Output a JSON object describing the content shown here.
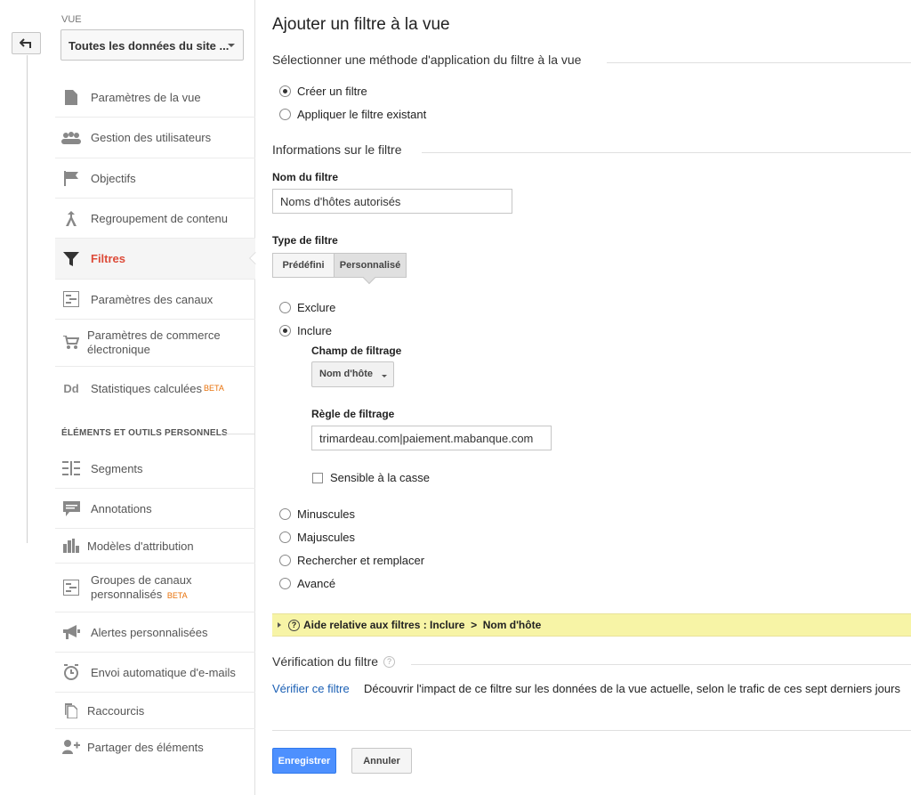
{
  "sidebar": {
    "view_label": "VUE",
    "view_select": "Toutes les données du site ...",
    "items": [
      {
        "label": "Paramètres de la vue",
        "icon": "document-icon"
      },
      {
        "label": "Gestion des utilisateurs",
        "icon": "users-icon"
      },
      {
        "label": "Objectifs",
        "icon": "flag-icon"
      },
      {
        "label": "Regroupement de contenu",
        "icon": "merge-icon"
      },
      {
        "label": "Filtres",
        "icon": "filter-icon"
      },
      {
        "label": "Paramètres des canaux",
        "icon": "channels-icon"
      },
      {
        "label": "Paramètres de commerce électronique",
        "icon": "cart-icon"
      },
      {
        "label": "Statistiques calculées",
        "icon": "dd-icon",
        "badge": "BETA"
      }
    ],
    "section_title": "ÉLÉMENTS ET OUTILS PERSONNELS",
    "personal_items": [
      {
        "label": "Segments",
        "icon": "segments-icon"
      },
      {
        "label": "Annotations",
        "icon": "comment-icon"
      },
      {
        "label": "Modèles d'attribution",
        "icon": "bar-chart-icon"
      },
      {
        "label": "Groupes de canaux personnalisés",
        "icon": "channels-icon",
        "badge": "BETA"
      },
      {
        "label": "Alertes personnalisées",
        "icon": "megaphone-icon"
      },
      {
        "label": "Envoi automatique d'e-mails",
        "icon": "clock-icon"
      },
      {
        "label": "Raccourcis",
        "icon": "copy-icon"
      },
      {
        "label": "Partager des éléments",
        "icon": "add-user-icon"
      }
    ]
  },
  "main": {
    "title": "Ajouter un filtre à la vue",
    "method_heading": "Sélectionner une méthode d'application du filtre à la vue",
    "method_options": [
      "Créer un filtre",
      "Appliquer le filtre existant"
    ],
    "info_heading": "Informations sur le filtre",
    "name_label": "Nom du filtre",
    "name_value": "Noms d'hôtes autorisés",
    "type_label": "Type de filtre",
    "type_tabs": [
      "Prédéfini",
      "Personnalisé"
    ],
    "custom_options": [
      "Exclure",
      "Inclure",
      "Minuscules",
      "Majuscules",
      "Rechercher et remplacer",
      "Avancé"
    ],
    "field_label": "Champ de filtrage",
    "field_value": "Nom d'hôte",
    "rule_label": "Règle de filtrage",
    "rule_value": "trimardeau.com|paiement.mabanque.com",
    "case_label": "Sensible à la casse",
    "help_text": "Aide relative aux filtres : Inclure  >  Nom d'hôte",
    "verify_heading": "Vérification du filtre",
    "verify_link": "Vérifier ce filtre",
    "verify_desc": "Découvrir l'impact de ce filtre sur les données de la vue actuelle, selon le trafic de ces sept derniers jours",
    "save_label": "Enregistrer",
    "cancel_label": "Annuler"
  },
  "colors": {
    "accent_active": "#dd4b39",
    "primary_button": "#4d90fe",
    "link": "#1a5fb4",
    "help_bar": "#f7f4a6",
    "beta": "#e8710a"
  }
}
